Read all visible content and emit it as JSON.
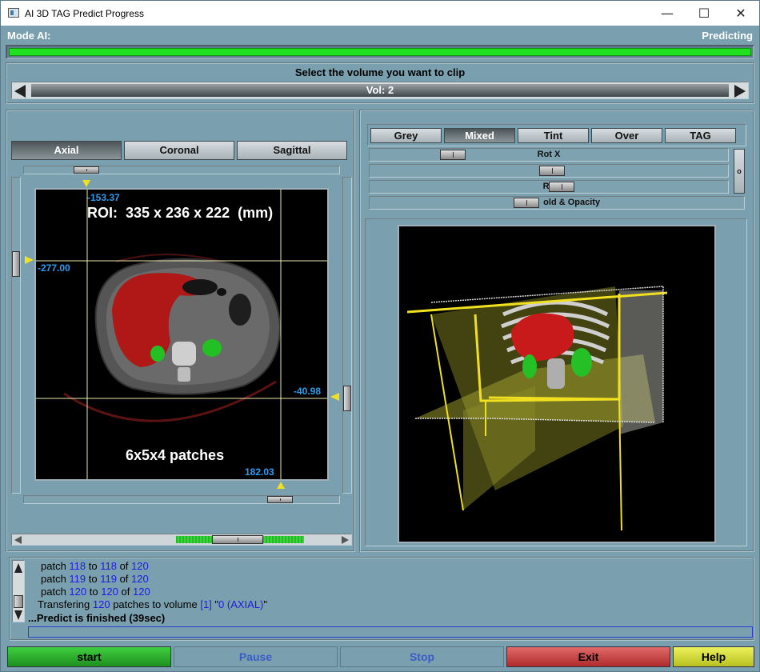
{
  "window": {
    "title": "AI 3D TAG Predict Progress",
    "minimize": "—",
    "maximize": "☐",
    "close": "✕"
  },
  "header": {
    "mode_label": "Mode AI:",
    "status": "Predicting",
    "progress": 1.0,
    "progress_color": "#20e020"
  },
  "volume": {
    "prompt": "Select the volume you want to clip",
    "value": "Vol: 2"
  },
  "left": {
    "tabs": [
      "Axial",
      "Coronal",
      "Sagittal"
    ],
    "active_tab": "Axial",
    "annotations": {
      "top": "-153.37",
      "left": "-277.00",
      "right": "-40.98",
      "bottom": "182.03"
    },
    "roi": "ROI:  335 x 236 x 222  (mm)",
    "patches": "6x5x4 patches"
  },
  "right": {
    "modes": [
      "Grey",
      "Mixed",
      "Tint",
      "Over",
      "TAG"
    ],
    "active_mode": "Mixed",
    "sliders": [
      "Rot X",
      "R",
      "Ro",
      "T          old & Opacity"
    ]
  },
  "log": {
    "lines": [
      {
        "pre": "patch ",
        "a": "118",
        "mid": " to ",
        "b": "118",
        "mid2": " of ",
        "c": "120"
      },
      {
        "pre": "patch ",
        "a": "119",
        "mid": " to ",
        "b": "119",
        "mid2": " of ",
        "c": "120"
      },
      {
        "pre": "patch ",
        "a": "120",
        "mid": " to ",
        "b": "120",
        "mid2": " of ",
        "c": "120"
      }
    ],
    "transfer": {
      "t1": "Transfering ",
      "n": "120",
      "t2": " patches to volume ",
      "v": "[1]",
      "t3": " \"",
      "name": "0 (AXIAL)",
      "t4": "\""
    },
    "finished": "...Predict is finished (39sec)"
  },
  "buttons": {
    "start": "start",
    "pause": "Pause",
    "stop": "Stop",
    "exit": "Exit",
    "help": "Help"
  },
  "colors": {
    "start": "#2fbf2f",
    "exit": "#d24b4b",
    "help": "#d8e23a",
    "disabled_text": "#3a5cc8"
  }
}
